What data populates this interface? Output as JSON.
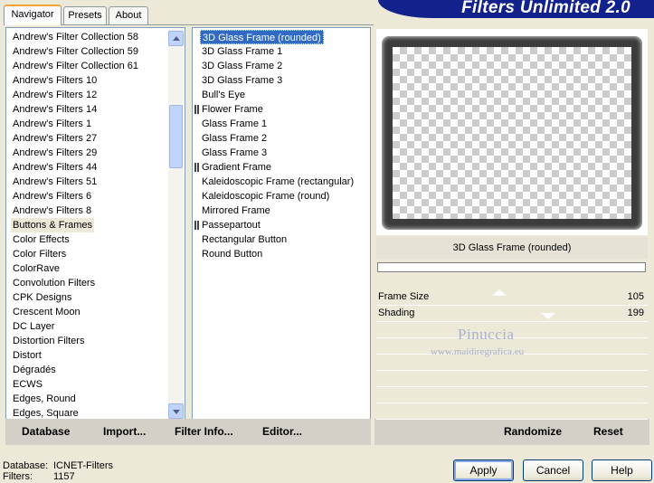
{
  "tabs": [
    {
      "label": "Navigator",
      "active": true
    },
    {
      "label": "Presets",
      "active": false
    },
    {
      "label": "About",
      "active": false
    }
  ],
  "banner": {
    "title": "Filters Unlimited 2.0"
  },
  "categories": {
    "items": [
      "Andrew's Filter Collection 58",
      "Andrew's Filter Collection 59",
      "Andrew's Filter Collection 61",
      "Andrew's Filters 10",
      "Andrew's Filters 12",
      "Andrew's Filters 14",
      "Andrew's Filters 1",
      "Andrew's Filters 27",
      "Andrew's Filters 29",
      "Andrew's Filters 44",
      "Andrew's Filters 51",
      "Andrew's Filters 6",
      "Andrew's Filters 8",
      "Buttons & Frames",
      "Color Effects",
      "Color Filters",
      "ColorRave",
      "Convolution Filters",
      "CPK Designs",
      "Crescent Moon",
      "DC Layer",
      "Distortion Filters",
      "Distort",
      "Dégradés",
      "ECWS",
      "Edges, Round",
      "Edges, Square"
    ],
    "selected_index": 13
  },
  "filters": {
    "items": [
      {
        "label": "3D Glass Frame (rounded)",
        "marker": false
      },
      {
        "label": "3D Glass Frame 1",
        "marker": false
      },
      {
        "label": "3D Glass Frame 2",
        "marker": false
      },
      {
        "label": "3D Glass Frame 3",
        "marker": false
      },
      {
        "label": "Bull's Eye",
        "marker": false
      },
      {
        "label": "Flower Frame",
        "marker": true
      },
      {
        "label": "Glass Frame 1",
        "marker": false
      },
      {
        "label": "Glass Frame 2",
        "marker": false
      },
      {
        "label": "Glass Frame 3",
        "marker": false
      },
      {
        "label": "Gradient Frame",
        "marker": true
      },
      {
        "label": "Kaleidoscopic Frame (rectangular)",
        "marker": false
      },
      {
        "label": "Kaleidoscopic Frame (round)",
        "marker": false
      },
      {
        "label": "Mirrored Frame",
        "marker": false
      },
      {
        "label": "Passepartout",
        "marker": true
      },
      {
        "label": "Rectangular Button",
        "marker": false
      },
      {
        "label": "Round Button",
        "marker": false
      }
    ],
    "selected_index": 0
  },
  "toolbar": {
    "database": "Database",
    "import": "Import...",
    "filter_info": "Filter Info...",
    "editor": "Editor...",
    "randomize": "Randomize",
    "reset": "Reset"
  },
  "preview": {
    "selected_filter_name": "3D Glass Frame (rounded)"
  },
  "params": [
    {
      "label": "Frame Size",
      "value": "105",
      "max": 255
    },
    {
      "label": "Shading",
      "value": "199",
      "max": 255
    }
  ],
  "watermark": {
    "name": "Pinuccia",
    "url": "www.maidiregrafica.eu"
  },
  "status": {
    "database_label": "Database:",
    "database_value": "ICNET-Filters",
    "filters_label": "Filters:",
    "filters_value": "1157"
  },
  "buttons": {
    "apply": "Apply",
    "cancel": "Cancel",
    "help": "Help"
  },
  "colors": {
    "selection": "#316ac5",
    "banner": "#12218b",
    "accent_tab": "#f2a43c"
  }
}
